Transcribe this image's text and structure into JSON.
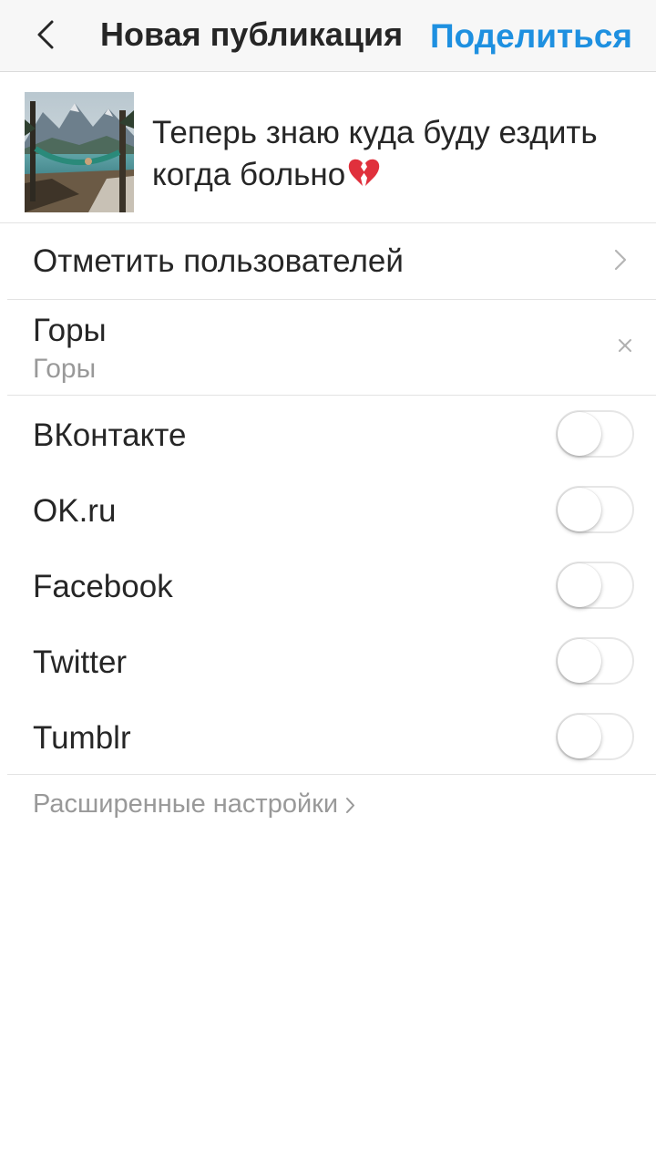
{
  "header": {
    "back_icon": "chevron-left-icon",
    "title": "Новая публикация",
    "share_label": "Поделиться",
    "share_color": "#1e90e0"
  },
  "post": {
    "caption": "Теперь знаю куда буду ездить когда больно",
    "caption_emoji": "💔",
    "thumbnail": "mountain-lake-hammock-photo"
  },
  "tag_people": {
    "label": "Отметить пользователей",
    "icon": "chevron-right-icon"
  },
  "location": {
    "title": "Горы",
    "subtitle": "Горы",
    "clear_icon": "close-icon"
  },
  "share_targets": [
    {
      "label": "ВКонтакте",
      "enabled": false
    },
    {
      "label": "OK.ru",
      "enabled": false
    },
    {
      "label": "Facebook",
      "enabled": false
    },
    {
      "label": "Twitter",
      "enabled": false
    },
    {
      "label": "Tumblr",
      "enabled": false
    }
  ],
  "advanced_settings": {
    "label": "Расширенные настройки",
    "icon": "chevron-right-icon"
  }
}
